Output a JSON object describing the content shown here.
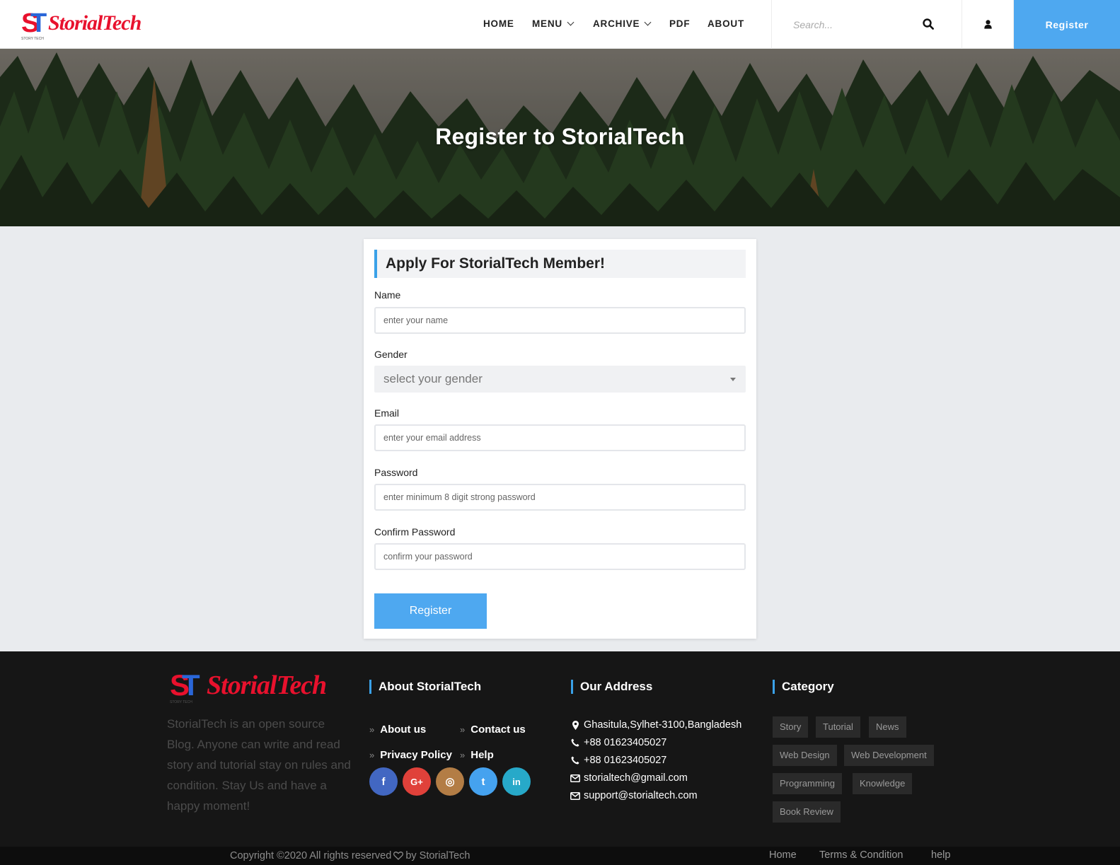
{
  "brand": {
    "name": "StorialTech",
    "mark_s": "S",
    "mark_t": "T",
    "mark_small": "STORY TECH",
    "red": "#e8112d",
    "blue": "#2a66d8"
  },
  "nav": {
    "home": "HOME",
    "menu": "MENU",
    "archive": "ARCHIVE",
    "pdf": "PDF",
    "about": "ABOUT"
  },
  "search": {
    "placeholder": "Search..."
  },
  "header": {
    "register_label": "Register"
  },
  "hero": {
    "title": "Register to StorialTech"
  },
  "form": {
    "title": "Apply For StorialTech Member!",
    "name_label": "Name",
    "name_placeholder": "enter your name",
    "gender_label": "Gender",
    "gender_value": "select your gender",
    "email_label": "Email",
    "email_placeholder": "enter your email address",
    "password_label": "Password",
    "password_placeholder": "enter minimum 8 digit strong password",
    "confirm_label": "Confirm Password",
    "confirm_placeholder": "confirm your password",
    "submit_label": "Register"
  },
  "footer": {
    "about_text": "StorialTech is an open source Blog. Anyone can write and read story and tutorial stay on rules and condition. Stay Us and have a happy moment!",
    "about_heading": "About StorialTech",
    "links": {
      "about_us": "About us",
      "contact_us": "Contact us",
      "privacy": "Privacy Policy",
      "help": "Help"
    },
    "social": {
      "facebook": "f",
      "google": "G+",
      "instagram": "◎",
      "twitter": "t",
      "linkedin": "in"
    },
    "address_heading": "Our Address",
    "address": "Ghasitula,Sylhet-3100,Bangladesh",
    "phone1": "+88 01623405027",
    "phone2": "+88 01623405027",
    "email1": "storialtech@gmail.com",
    "email2": "support@storialtech.com",
    "category_heading": "Category",
    "categories": [
      "Story",
      "Tutorial",
      "News",
      "Web Design",
      "Web Development",
      "Programming",
      "Knowledge",
      "Book Review"
    ],
    "copyright_pre": "Copyright ©2020 All rights reserved",
    "copyright_post": "by StorialTech",
    "bottom_links": {
      "home": "Home",
      "terms": "Terms & Condition",
      "help": "help"
    }
  },
  "colors": {
    "accent": "#4ea8f0",
    "footer_bg": "#161616",
    "facebook": "#4267c2",
    "google": "#e0413a",
    "instagram": "#b37d45",
    "twitter": "#45a2ef",
    "linkedin": "#27a9c9"
  }
}
